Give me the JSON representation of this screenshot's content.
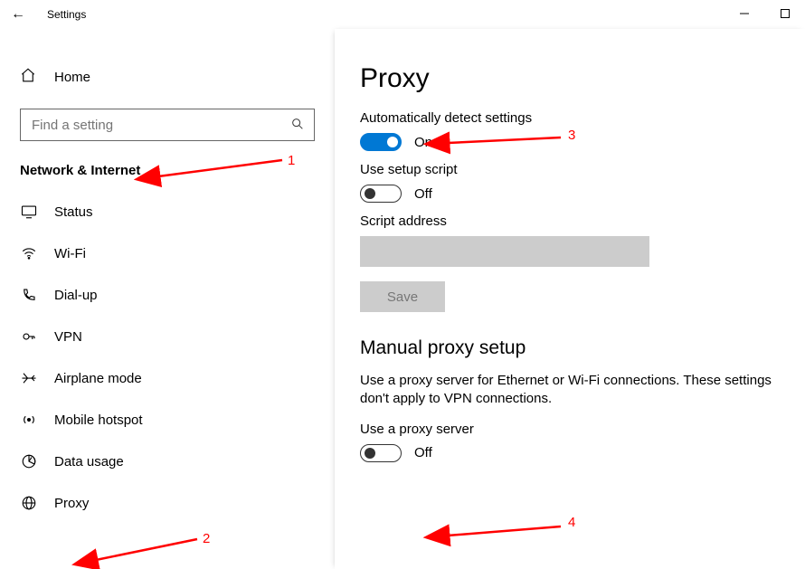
{
  "titlebar": {
    "back_glyph": "←",
    "title": "Settings"
  },
  "sidebar": {
    "home_label": "Home",
    "search_placeholder": "Find a setting",
    "category_label": "Network & Internet",
    "items": [
      {
        "icon": "monitor-icon",
        "label": "Status"
      },
      {
        "icon": "wifi-icon",
        "label": "Wi-Fi"
      },
      {
        "icon": "phone-icon",
        "label": "Dial-up"
      },
      {
        "icon": "lock-icon",
        "label": "VPN"
      },
      {
        "icon": "airplane-icon",
        "label": "Airplane mode"
      },
      {
        "icon": "hotspot-icon",
        "label": "Mobile hotspot"
      },
      {
        "icon": "gauge-icon",
        "label": "Data usage"
      },
      {
        "icon": "globe-icon",
        "label": "Proxy"
      }
    ]
  },
  "content": {
    "heading": "Proxy",
    "auto_detect": {
      "label": "Automatically detect settings",
      "state": "On",
      "on": true
    },
    "setup_script": {
      "label": "Use setup script",
      "state": "Off",
      "on": false
    },
    "script_address_label": "Script address",
    "save_label": "Save",
    "manual_heading": "Manual proxy setup",
    "manual_desc": "Use a proxy server for Ethernet or Wi-Fi connections. These settings don't apply to VPN connections.",
    "use_proxy": {
      "label": "Use a proxy server",
      "state": "Off",
      "on": false
    }
  },
  "annotations": {
    "a1": "1",
    "a2": "2",
    "a3": "3",
    "a4": "4"
  }
}
